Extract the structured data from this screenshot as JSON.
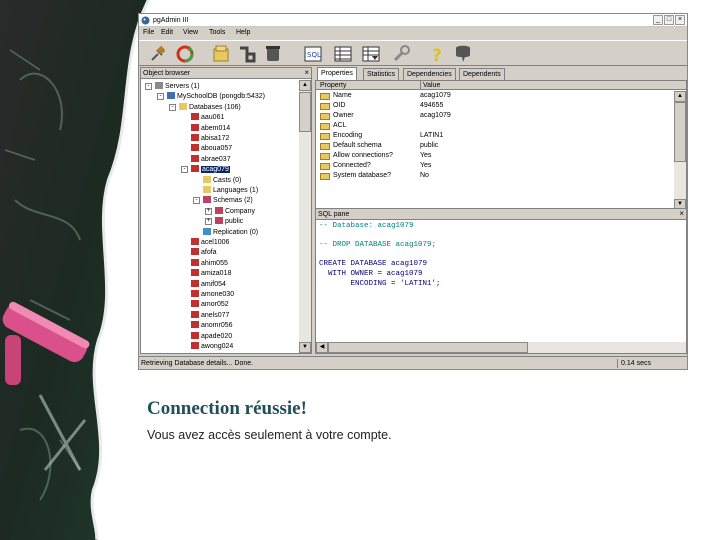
{
  "window": {
    "title": "pgAdmin III",
    "min": "_",
    "max": "□",
    "close": "×"
  },
  "menu": [
    "File",
    "Edit",
    "View",
    "Tools",
    "Help"
  ],
  "browser": {
    "title": "Object browser",
    "close": "×",
    "tree": [
      {
        "label": "Servers (1)",
        "icon": "servers-icon",
        "depth": 0,
        "expander": "-"
      },
      {
        "label": "MySchoolDB (pongdb:5432)",
        "icon": "server-icon",
        "depth": 1,
        "expander": "-"
      },
      {
        "label": "Databases (106)",
        "icon": "databases-icon",
        "depth": 2,
        "expander": "-"
      },
      {
        "label": "aau061",
        "icon": "database-icon",
        "depth": 3
      },
      {
        "label": "abem014",
        "icon": "database-icon",
        "depth": 3
      },
      {
        "label": "abisa172",
        "icon": "database-icon",
        "depth": 3
      },
      {
        "label": "aboua057",
        "icon": "database-icon",
        "depth": 3
      },
      {
        "label": "abrae037",
        "icon": "database-icon",
        "depth": 3
      },
      {
        "label": "acag079",
        "icon": "database-icon",
        "depth": 3,
        "expander": "-",
        "selected": true
      },
      {
        "label": "Casts (0)",
        "icon": "casts-icon",
        "depth": 4
      },
      {
        "label": "Languages (1)",
        "icon": "languages-icon",
        "depth": 4
      },
      {
        "label": "Schemas (2)",
        "icon": "schemas-icon",
        "depth": 4,
        "expander": "-"
      },
      {
        "label": "Company",
        "icon": "schema-icon",
        "depth": 5,
        "expander": "+"
      },
      {
        "label": "public",
        "icon": "schema-icon",
        "depth": 5,
        "expander": "+"
      },
      {
        "label": "Replication (0)",
        "icon": "replication-icon",
        "depth": 4
      },
      {
        "label": "acel1006",
        "icon": "database-icon",
        "depth": 3
      },
      {
        "label": "afofa",
        "icon": "database-icon",
        "depth": 3
      },
      {
        "label": "ahim055",
        "icon": "database-icon",
        "depth": 3
      },
      {
        "label": "amiza018",
        "icon": "database-icon",
        "depth": 3
      },
      {
        "label": "amif054",
        "icon": "database-icon",
        "depth": 3
      },
      {
        "label": "amone030",
        "icon": "database-icon",
        "depth": 3
      },
      {
        "label": "amor052",
        "icon": "database-icon",
        "depth": 3
      },
      {
        "label": "anels077",
        "icon": "database-icon",
        "depth": 3
      },
      {
        "label": "anomr056",
        "icon": "database-icon",
        "depth": 3
      },
      {
        "label": "apade020",
        "icon": "database-icon",
        "depth": 3
      },
      {
        "label": "awong024",
        "icon": "database-icon",
        "depth": 3
      }
    ]
  },
  "tabs": [
    "Properties",
    "Statistics",
    "Dependencies",
    "Dependents"
  ],
  "properties": {
    "col_property": "Property",
    "col_value": "Value",
    "rows": [
      {
        "k": "Name",
        "v": "acag1079"
      },
      {
        "k": "OID",
        "v": "494655"
      },
      {
        "k": "Owner",
        "v": "acag1079"
      },
      {
        "k": "ACL",
        "v": ""
      },
      {
        "k": "Encoding",
        "v": "LATIN1"
      },
      {
        "k": "Default schema",
        "v": "public"
      },
      {
        "k": "Allow connections?",
        "v": "Yes"
      },
      {
        "k": "Connected?",
        "v": "Yes"
      },
      {
        "k": "System database?",
        "v": "No"
      }
    ]
  },
  "sql": {
    "title": "SQL pane",
    "close": "×",
    "lines": [
      {
        "text": "-- Database: acag1079",
        "cls": "c-comment"
      },
      {
        "text": "",
        "cls": ""
      },
      {
        "text": "-- DROP DATABASE acag1079;",
        "cls": "c-comment"
      },
      {
        "text": "",
        "cls": ""
      },
      {
        "text": "CREATE DATABASE acag1079",
        "cls": "c-key"
      },
      {
        "text": "  WITH OWNER = acag1079",
        "cls": "c-key"
      },
      {
        "text": "       ENCODING = 'LATIN1';",
        "cls": "c-key"
      }
    ]
  },
  "status": {
    "message": "Retrieving Database details... Done.",
    "time": "0.14 secs"
  },
  "caption": {
    "title": "Connection réussie!",
    "body": "Vous avez accès seulement à votre compte."
  }
}
